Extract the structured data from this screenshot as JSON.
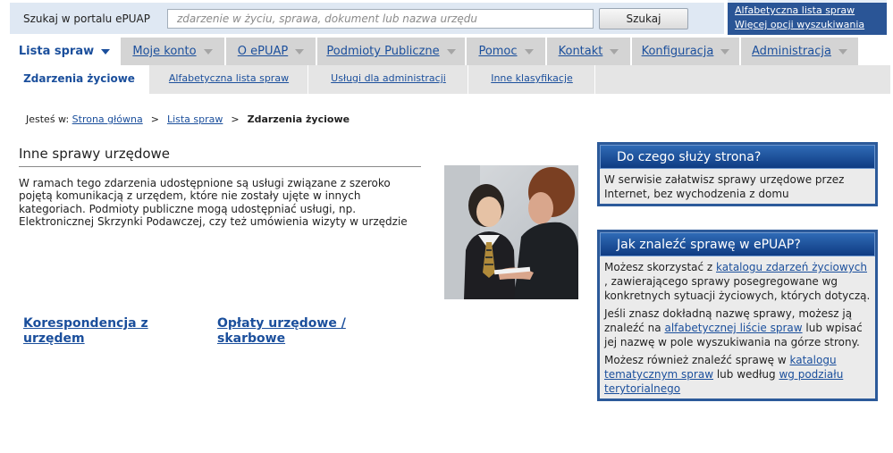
{
  "search": {
    "label": "Szukaj w portalu ePUAP",
    "placeholder": "zdarzenie w życiu, sprawa, dokument lub nazwa urzędu",
    "button_label": "Szukaj",
    "alpha_list_link": "Alfabetyczna lista spraw",
    "more_options_link": "Więcej opcji wyszukiwania"
  },
  "main_nav": [
    {
      "label": "Lista spraw",
      "active": true
    },
    {
      "label": "Moje konto",
      "active": false
    },
    {
      "label": "O ePUAP",
      "active": false
    },
    {
      "label": "Podmioty Publiczne",
      "active": false
    },
    {
      "label": "Pomoc",
      "active": false
    },
    {
      "label": "Kontakt",
      "active": false
    },
    {
      "label": "Konfiguracja",
      "active": false
    },
    {
      "label": "Administracja",
      "active": false
    }
  ],
  "sub_nav": [
    {
      "label": "Zdarzenia życiowe",
      "active": true
    },
    {
      "label": "Alfabetyczna lista spraw",
      "active": false
    },
    {
      "label": "Usługi dla administracji",
      "active": false
    },
    {
      "label": "Inne klasyfikacje",
      "active": false
    }
  ],
  "breadcrumb": {
    "prefix": "Jesteś w:",
    "home": "Strona główna",
    "list": "Lista spraw",
    "current": "Zdarzenia życiowe",
    "separator": ">"
  },
  "section": {
    "title": "Inne sprawy urzędowe",
    "description": "W ramach tego zdarzenia udostępnione są usługi związane z szeroko pojętą komunikacją z urzędem, które nie zostały ujęte w innych kategoriach. Podmioty publiczne mogą udostępniać usługi, np. Elektronicznej Skrzynki Podawczej, czy też umówienia wizyty w urzędzie"
  },
  "services": [
    {
      "label": "Korespondencja z urzędem"
    },
    {
      "label": "Opłaty urzędowe / skarbowe"
    }
  ],
  "info_box_1": {
    "title": "Do czego służy strona?",
    "text": "W serwisie załatwisz sprawy urzędowe przez Internet, bez wychodzenia z domu"
  },
  "info_box_2": {
    "title": "Jak znaleźć sprawę w ePUAP?",
    "p1_before": "Możesz skorzystać z ",
    "p1_link": "katalogu zdarzeń życiowych",
    "p1_after": " , zawierającego sprawy posegregowane wg konkretnych sytuacji życiowych, których dotyczą.",
    "p2_before": "Jeśli znasz dokładną nazwę sprawy, możesz ją znaleźć na ",
    "p2_link": "alfabetycznej liście spraw",
    "p2_after": " lub wpisać jej nazwę w pole wyszukiwania na górze strony.",
    "p3_before": "Możesz również znaleźć sprawę w ",
    "p3_link1": "katalogu tematycznym spraw",
    "p3_mid": " lub według ",
    "p3_link2": "wg podziału terytorialnego"
  },
  "colors": {
    "brand_blue": "#2a5596",
    "link_blue": "#1b4f9c",
    "tab_gray": "#d4d4d4",
    "sub_nav_gray": "#e5e5e5",
    "box_body_gray": "#ebebeb"
  },
  "icons": {
    "dropdown": "chevron-down-icon",
    "photo": "photo-clerk-customer"
  }
}
